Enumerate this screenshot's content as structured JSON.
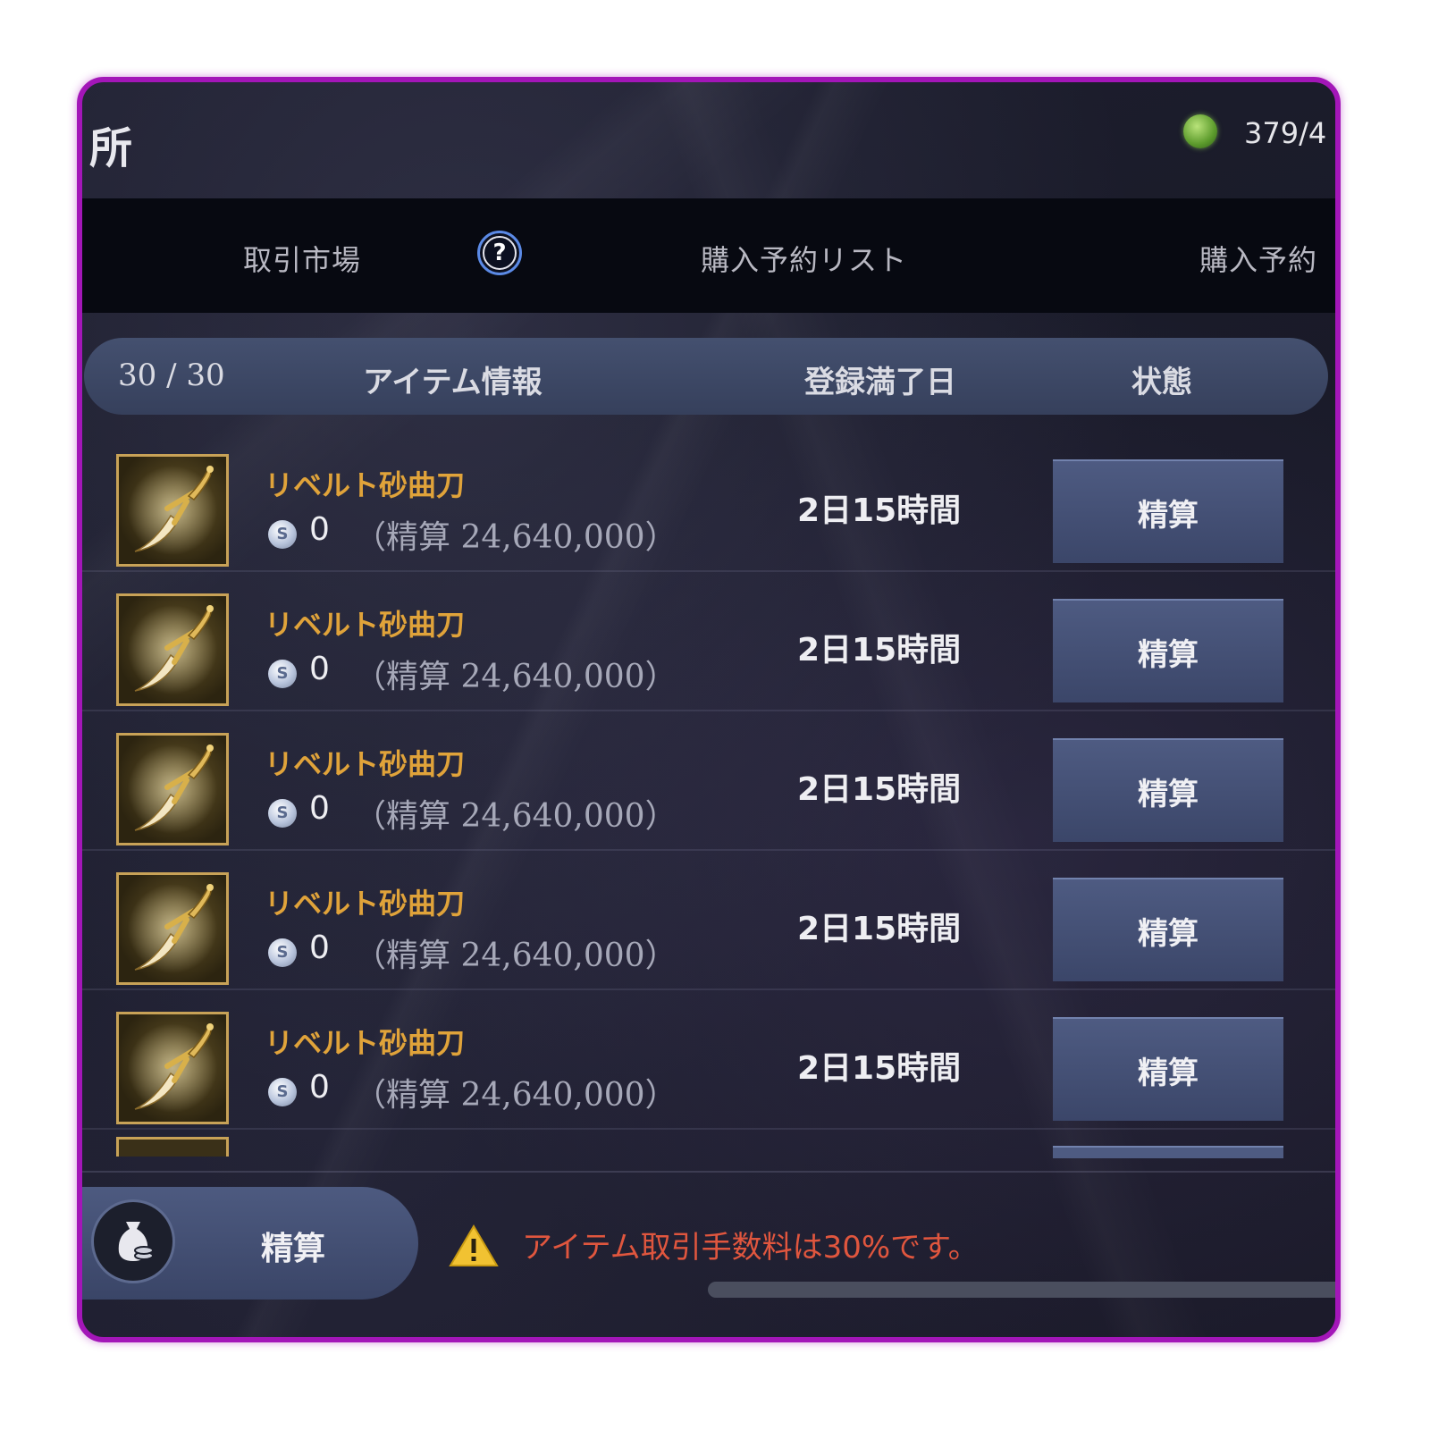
{
  "header": {
    "title": "所",
    "resource_icon": "green-gem-icon",
    "resource_text": "379/4"
  },
  "tabs": [
    {
      "label": "取引市場"
    },
    {
      "label": "購入予約リスト"
    },
    {
      "label": "購入予約"
    }
  ],
  "help_icon": {
    "glyph": "?"
  },
  "table": {
    "count": "30 / 30",
    "col_item": "アイテム情報",
    "col_date": "登録満了日",
    "col_status": "状態"
  },
  "rows": [
    {
      "name": "リベルト砂曲刀",
      "amount": "0",
      "settle": "（精算 24,640,000）",
      "date": "2日15時間",
      "button": "精算"
    },
    {
      "name": "リベルト砂曲刀",
      "amount": "0",
      "settle": "（精算 24,640,000）",
      "date": "2日15時間",
      "button": "精算"
    },
    {
      "name": "リベルト砂曲刀",
      "amount": "0",
      "settle": "（精算 24,640,000）",
      "date": "2日15時間",
      "button": "精算"
    },
    {
      "name": "リベルト砂曲刀",
      "amount": "0",
      "settle": "（精算 24,640,000）",
      "date": "2日15時間",
      "button": "精算"
    },
    {
      "name": "リベルト砂曲刀",
      "amount": "0",
      "settle": "（精算 24,640,000）",
      "date": "2日15時間",
      "button": "精算"
    }
  ],
  "coin_glyph": "S",
  "footer": {
    "settle_all_label": "精算",
    "settle_all_icon": "money-bag-icon",
    "warning_icon": "warning-triangle-icon",
    "warning_text": "アイテム取引手数料は30%です。"
  },
  "colors": {
    "frame": "#a316b8",
    "item_name": "#e0a33a",
    "warning": "#e0563e",
    "button": "#4e5b82"
  }
}
